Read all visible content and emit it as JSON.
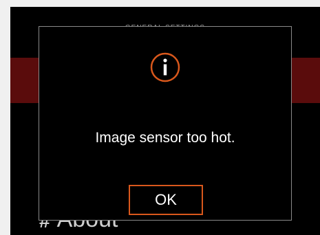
{
  "background": {
    "section_header": "GENERAL SETTINGS",
    "about_prefix": "#",
    "about_label": "About"
  },
  "dialog": {
    "icon": "info-icon",
    "message": "Image sensor too hot.",
    "ok_label": "OK"
  },
  "colors": {
    "accent": "#d9581c",
    "highlight": "#5a0c0c",
    "dialog_border": "#8a8a8a",
    "background": "#000000"
  }
}
